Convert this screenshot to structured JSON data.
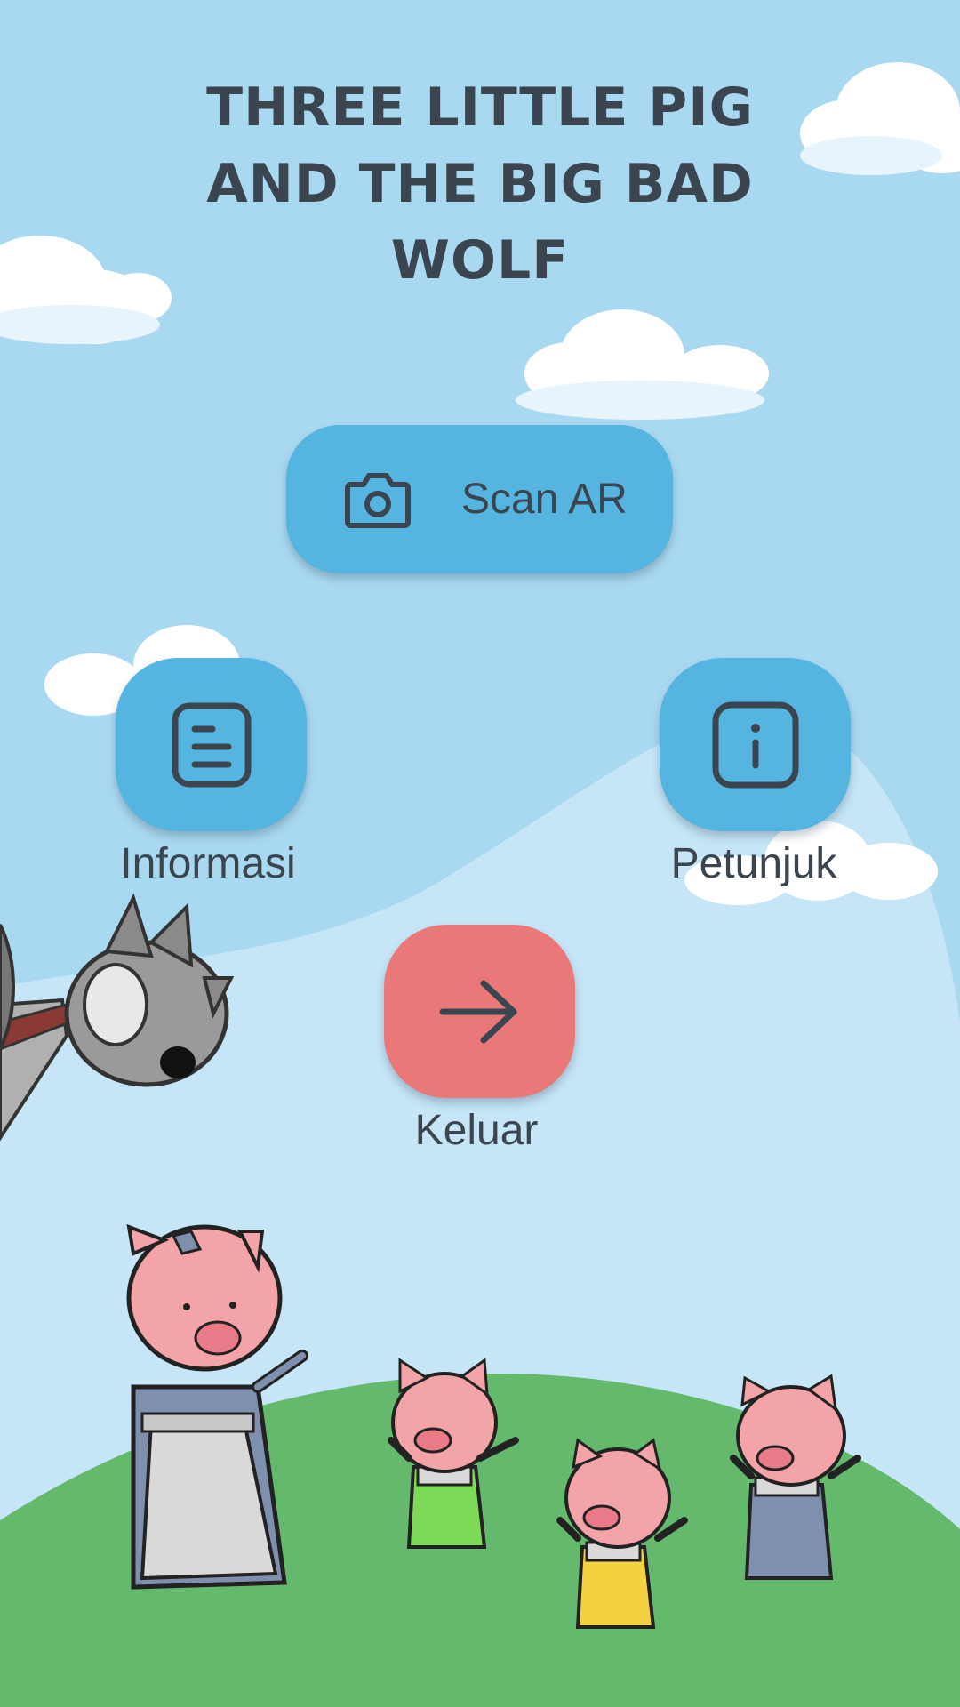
{
  "title": {
    "line1": "THREE LITTLE PIG",
    "line2": "AND THE BIG BAD",
    "line3": "WOLF"
  },
  "buttons": {
    "scan": {
      "label": "Scan AR",
      "icon": "camera-icon"
    },
    "info": {
      "label": "Informasi",
      "icon": "document-icon"
    },
    "help": {
      "label": "Petunjuk",
      "icon": "info-icon"
    },
    "exit": {
      "label": "Keluar",
      "icon": "arrow-right-icon"
    }
  },
  "colors": {
    "sky": "#a9d9f1",
    "hill": "#c6e6f7",
    "grass": "#64b96c",
    "button_blue": "#56b5e0",
    "button_red": "#eb7878",
    "text_dark": "#3b4550"
  }
}
